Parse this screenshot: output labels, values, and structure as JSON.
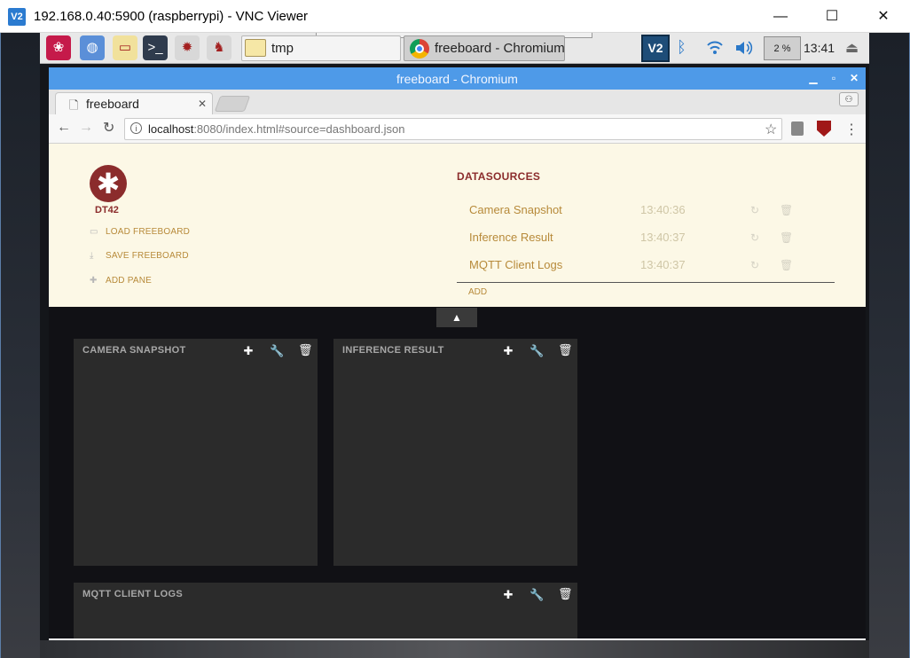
{
  "vnc_window": {
    "app_icon": "V2",
    "title": "192.168.0.40:5900 (raspberrypi) - VNC Viewer",
    "controls": {
      "minimize": "—",
      "maximize": "☐",
      "close": "✕"
    }
  },
  "pi_taskbar": {
    "launchers": [
      {
        "name": "raspberry-menu-icon",
        "glyph": "❀",
        "bg": "#c51a4a"
      },
      {
        "name": "web-browser-icon",
        "glyph": "◍",
        "bg": "#5b8fd8"
      },
      {
        "name": "file-manager-icon",
        "glyph": "▭",
        "bg": "#f1e19c"
      },
      {
        "name": "terminal-icon",
        "glyph": ">_",
        "bg": "#2f3b4d"
      },
      {
        "name": "mathematica-icon",
        "glyph": "✹",
        "bg": "#d8d8d8"
      },
      {
        "name": "wolfram-icon",
        "glyph": "♞",
        "bg": "#d8d8d8"
      }
    ],
    "tasks": [
      {
        "label": "tmp"
      },
      {
        "label": "freeboard - Chromium"
      }
    ],
    "tray": {
      "vnc_label": "V2",
      "cpu": "2 %",
      "clock": "13:41"
    }
  },
  "chromium": {
    "title": "freeboard - Chromium",
    "tab_title": "freeboard",
    "url_host": "localhost",
    "url_rest": ":8080/index.html#source=dashboard.json"
  },
  "freeboard": {
    "logo_text": "DT42",
    "actions": [
      "LOAD FREEBOARD",
      "SAVE FREEBOARD",
      "ADD PANE"
    ],
    "datasources_title": "DATASOURCES",
    "datasources": [
      {
        "name": "Camera Snapshot",
        "time": "13:40:36"
      },
      {
        "name": "Inference Result",
        "time": "13:40:37"
      },
      {
        "name": "MQTT Client Logs",
        "time": "13:40:37"
      }
    ],
    "add_label": "ADD",
    "panes": [
      {
        "title": "CAMERA SNAPSHOT"
      },
      {
        "title": "INFERENCE RESULT"
      },
      {
        "title": "MQTT CLIENT LOGS"
      }
    ]
  },
  "colors": {
    "chromium_title_bar": "#4e9ae8",
    "freeboard_header_bg": "#fcf8e6",
    "freeboard_accent": "#8b2c2c",
    "freeboard_link": "#b78a3a",
    "dashboard_bg": "#111115",
    "pane_bg": "#2b2b2b"
  }
}
